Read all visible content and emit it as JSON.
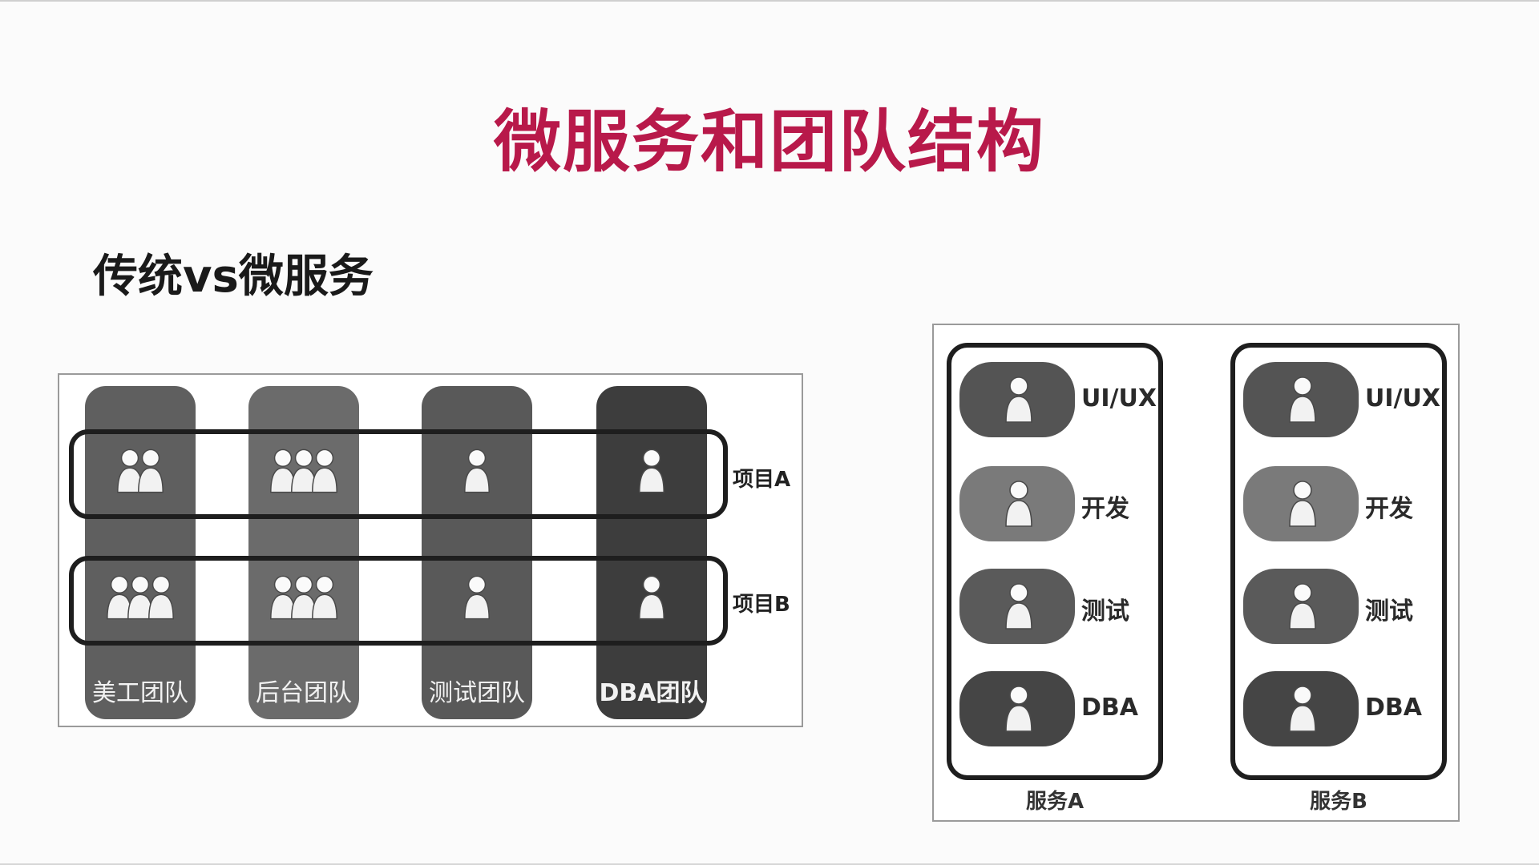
{
  "title": "微服务和团队结构",
  "subtitle": "传统vs微服务",
  "traditional": {
    "teams": [
      {
        "label": "美工团队",
        "color": "#5f5f5f",
        "project_a_people": 2,
        "project_b_people": 3
      },
      {
        "label": "后台团队",
        "color": "#6b6b6b",
        "project_a_people": 3,
        "project_b_people": 3
      },
      {
        "label": "测试团队",
        "color": "#595959",
        "project_a_people": 1,
        "project_b_people": 1
      },
      {
        "label": "DBA团队",
        "color": "#3d3d3d",
        "project_a_people": 1,
        "project_b_people": 1
      }
    ],
    "projects": [
      {
        "label": "项目A"
      },
      {
        "label": "项目B"
      }
    ]
  },
  "microservice": {
    "services": [
      {
        "label": "服务A",
        "roles": [
          {
            "label": "UI/UX",
            "color": "#545454"
          },
          {
            "label": "开发",
            "color": "#7a7a7a"
          },
          {
            "label": "测试",
            "color": "#5a5a5a"
          },
          {
            "label": "DBA",
            "color": "#454545"
          }
        ]
      },
      {
        "label": "服务B",
        "roles": [
          {
            "label": "UI/UX",
            "color": "#545454"
          },
          {
            "label": "开发",
            "color": "#7a7a7a"
          },
          {
            "label": "测试",
            "color": "#5a5a5a"
          },
          {
            "label": "DBA",
            "color": "#454545"
          }
        ]
      }
    ]
  }
}
